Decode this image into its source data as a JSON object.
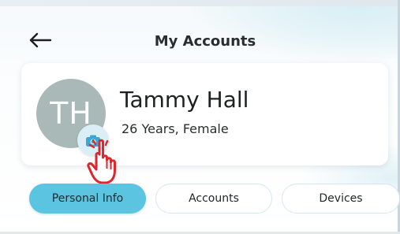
{
  "header": {
    "title": "My Accounts",
    "back_icon": "left-arrow-icon"
  },
  "profile": {
    "initials": "TH",
    "name": "Tammy Hall",
    "details": "26 Years, Female",
    "avatar_color": "#a9b9b8",
    "camera_icon": "camera-icon",
    "cursor_icon": "hand-pointer-icon"
  },
  "tabs": [
    {
      "label": "Personal Info",
      "active": true
    },
    {
      "label": "Accounts",
      "active": false
    },
    {
      "label": "Devices",
      "active": false
    }
  ],
  "colors": {
    "accent": "#5bc4e0",
    "camera_blue": "#3aa8d6",
    "pointer_red": "#e0262b"
  }
}
